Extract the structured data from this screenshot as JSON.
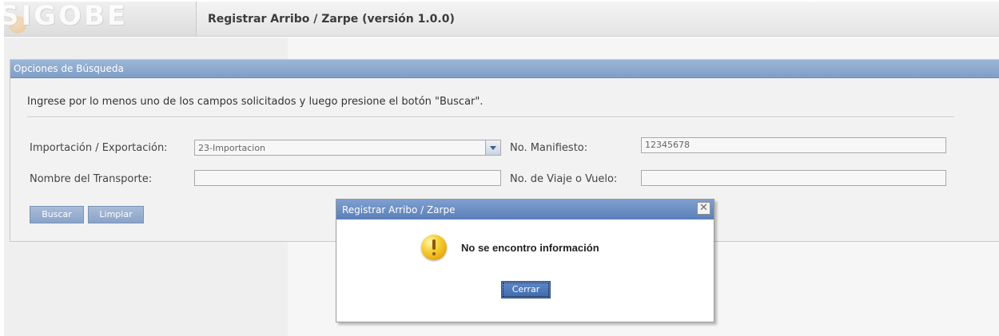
{
  "header": {
    "logo_text": "SIGOBE",
    "title": "Registrar Arribo / Zarpe (versión 1.0.0)"
  },
  "search_panel": {
    "title": "Opciones de Búsqueda",
    "instructions": "Ingrese por lo menos uno de los campos solicitados y luego presione el botón \"Buscar\".",
    "import_export": {
      "label": "Importación / Exportación:",
      "value": "23-Importacion"
    },
    "manifest": {
      "label": "No. Manifiesto:",
      "value": "12345678"
    },
    "transport_name": {
      "label": "Nombre del Transporte:",
      "value": ""
    },
    "trip_number": {
      "label": "No. de Viaje o Vuelo:",
      "value": ""
    },
    "buttons": {
      "search": "Buscar",
      "clear": "Limpiar"
    }
  },
  "dialog": {
    "title": "Registrar Arribo / Zarpe",
    "message": "No se encontro información",
    "close_button": "Cerrar",
    "icon": "warning-icon"
  },
  "colors": {
    "header_blue": "#7f9ec8",
    "button_blue": "#4a75b8",
    "warning_yellow": "#f6d23a"
  }
}
